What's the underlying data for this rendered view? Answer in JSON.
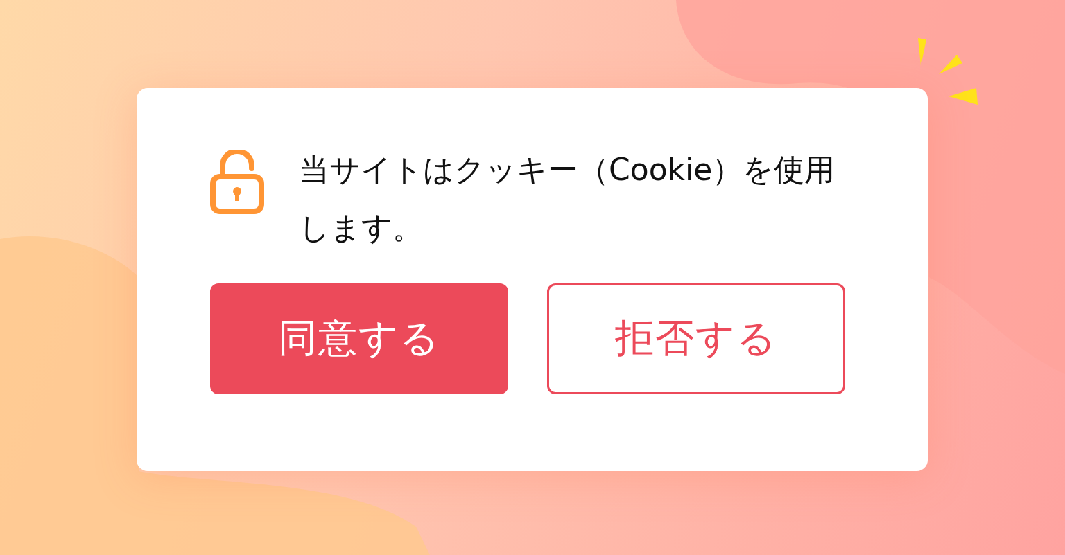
{
  "dialog": {
    "message": "当サイトはクッキー（Cookie）を使用します。",
    "buttons": [
      {
        "label": "同意する",
        "kind": "primary"
      },
      {
        "label": "拒否する",
        "kind": "secondary"
      }
    ]
  }
}
